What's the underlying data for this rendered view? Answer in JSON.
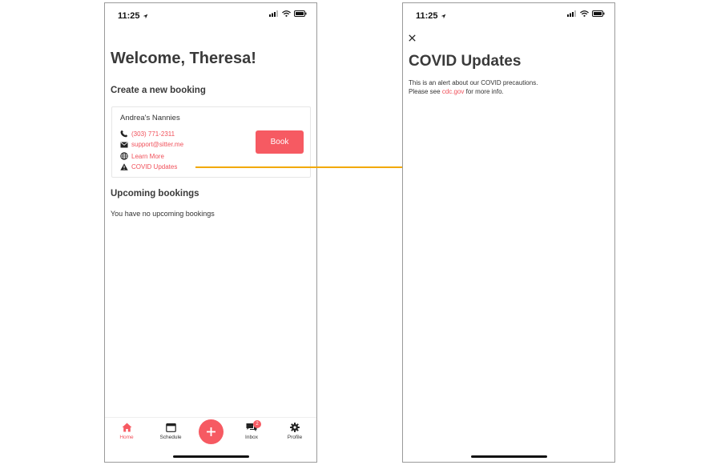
{
  "colors": {
    "accent": "#f65a62",
    "link": "#f0505a",
    "arrow": "#f2a900",
    "text": "#333333"
  },
  "home_screen": {
    "status_bar": {
      "time": "11:25"
    },
    "welcome": "Welcome, Theresa!",
    "create_heading": "Create a new booking",
    "card": {
      "title": "Andrea's Nannies",
      "phone": "(303) 771-2311",
      "email": "support@sitter.me",
      "learn_more": "Learn More",
      "covid_updates": "COVID Updates",
      "book_label": "Book",
      "icons": [
        "phone-icon",
        "mail-icon",
        "globe-icon",
        "warning-icon"
      ]
    },
    "upcoming_heading": "Upcoming bookings",
    "no_bookings": "You have no upcoming bookings",
    "tabbar": {
      "home": "Home",
      "schedule": "Schedule",
      "add": "+",
      "inbox": "Inbox",
      "inbox_badge": "2",
      "profile": "Profile"
    }
  },
  "covid_screen": {
    "status_bar": {
      "time": "11:25"
    },
    "title": "COVID Updates",
    "body_line1": "This is an alert about our COVID precautions.",
    "body_prefix": "Please see ",
    "link": "cdc.gov",
    "body_suffix": " for more info."
  }
}
